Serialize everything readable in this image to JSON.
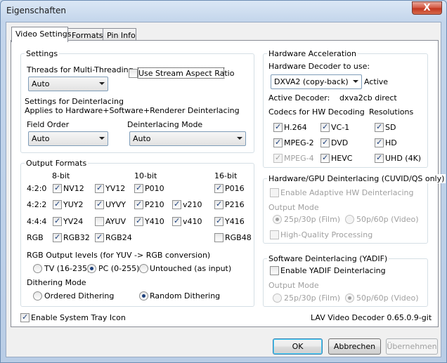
{
  "window": {
    "title": "Eigenschaften",
    "close_glyph": "X"
  },
  "tabs": [
    {
      "label": "Video Settings"
    },
    {
      "label": "Formats"
    },
    {
      "label": "Pin Info"
    }
  ],
  "settings": {
    "group_title": "Settings",
    "threads_label": "Threads for Multi-Threading",
    "threads_value": "Auto",
    "aspect_ratio_label": "Use Stream Aspect Ratio",
    "deint_title": "Settings for Deinterlacing",
    "deint_subtitle": "Applies to Hardware+Software+Renderer Deinterlacing",
    "field_order_label": "Field Order",
    "field_order_value": "Auto",
    "deint_mode_label": "Deinterlacing Mode",
    "deint_mode_value": "Auto"
  },
  "output_formats": {
    "group_title": "Output Formats",
    "headers": {
      "8bit": "8-bit",
      "10bit": "10-bit",
      "16bit": "16-bit"
    },
    "rows": {
      "r420": "4:2:0",
      "r422": "4:2:2",
      "r444": "4:4:4",
      "rgb": "RGB"
    },
    "items": {
      "nv12": "NV12",
      "yv12": "YV12",
      "p010": "P010",
      "p016": "P016",
      "yuy2": "YUY2",
      "uyvy": "UYVY",
      "p210": "P210",
      "v210": "v210",
      "p216": "P216",
      "yv24": "YV24",
      "ayuv": "AYUV",
      "y410": "Y410",
      "v410": "v410",
      "y416": "Y416",
      "rgb32": "RGB32",
      "rgb24": "RGB24",
      "rgb48": "RGB48"
    },
    "rgb_levels_label": "RGB Output levels (for YUV -> RGB conversion)",
    "rgb_levels": {
      "tv": "TV (16-235)",
      "pc": "PC (0-255)",
      "untouched": "Untouched (as input)"
    },
    "dithering_label": "Dithering Mode",
    "dithering": {
      "ordered": "Ordered Dithering",
      "random": "Random Dithering"
    }
  },
  "system_tray_label": "Enable System Tray Icon",
  "hw_accel": {
    "group_title": "Hardware Acceleration",
    "decoder_label": "Hardware Decoder to use:",
    "decoder_value": "DXVA2 (copy-back)",
    "decoder_status": "Active",
    "active_decoder_label": "Active Decoder:",
    "active_decoder_value": "dxva2cb direct",
    "codecs_label": "Codecs for HW Decoding",
    "resolutions_label": "Resolutions",
    "codecs": {
      "h264": "H.264",
      "vc1": "VC-1",
      "mpeg2": "MPEG-2",
      "dvd": "DVD",
      "mpeg4": "MPEG-4",
      "hevc": "HEVC"
    },
    "resolutions": {
      "sd": "SD",
      "hd": "HD",
      "uhd": "UHD (4K)"
    }
  },
  "hw_deint": {
    "group_title": "Hardware/GPU Deinterlacing (CUVID/QS only)",
    "enable_label": "Enable Adaptive HW Deinterlacing",
    "output_mode_label": "Output Mode",
    "opt_25p": "25p/30p (Film)",
    "opt_50p": "50p/60p (Video)",
    "hq_label": "High-Quality Processing"
  },
  "sw_deint": {
    "group_title": "Software Deinterlacing (YADIF)",
    "enable_label": "Enable YADIF Deinterlacing",
    "output_mode_label": "Output Mode",
    "opt_25p": "25p/30p (Film)",
    "opt_50p": "50p/60p (Video)"
  },
  "version": "LAV Video Decoder 0.65.0.9-git",
  "buttons": {
    "ok": "OK",
    "cancel": "Abbrechen",
    "apply": "Übernehmen"
  }
}
